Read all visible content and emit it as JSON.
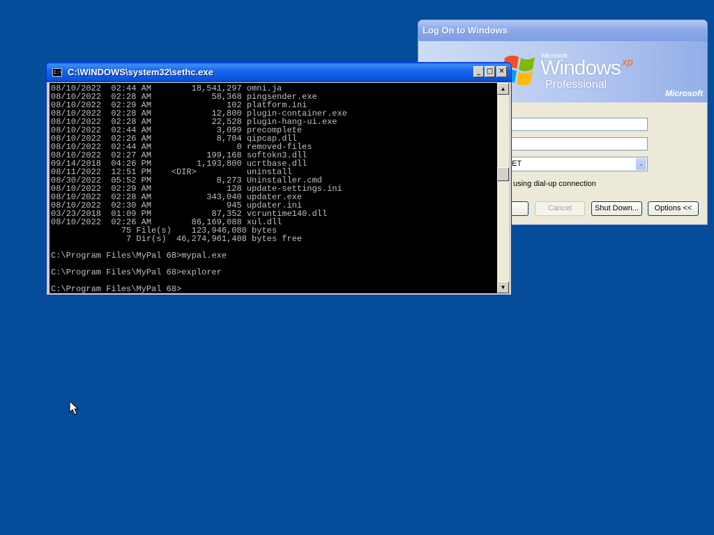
{
  "logon": {
    "title": "Log On to Windows",
    "brand_small": "Microsoft",
    "brand_windows": "Windows",
    "brand_xp": "xp",
    "brand_edition": "Professional",
    "brand_corner": "Microsoft",
    "domain_value": "ET",
    "dialup_label": "using dial-up connection",
    "cancel_label": "Cancel",
    "shutdown_label": "Shut Down...",
    "options_label": "Options <<"
  },
  "console": {
    "title": "C:\\WINDOWS\\system32\\sethc.exe",
    "minimize": "_",
    "maximize": "□",
    "close": "✕",
    "lines": [
      "08/10/2022  02:44 AM        18,541,297 omni.ja",
      "08/10/2022  02:28 AM            58,368 pingsender.exe",
      "08/10/2022  02:29 AM               102 platform.ini",
      "08/10/2022  02:28 AM            12,800 plugin-container.exe",
      "08/10/2022  02:28 AM            22,528 plugin-hang-ui.exe",
      "08/10/2022  02:44 AM             3,099 precomplete",
      "08/10/2022  02:26 AM             8,704 qipcap.dll",
      "08/10/2022  02:44 AM                 0 removed-files",
      "08/10/2022  02:27 AM           199,168 softokn3.dll",
      "09/14/2018  04:26 PM         1,193,800 ucrtbase.dll",
      "08/11/2022  12:51 PM    <DIR>          uninstall",
      "08/30/2022  05:52 PM             8,273 Uninstaller.cmd",
      "08/10/2022  02:29 AM               128 update-settings.ini",
      "08/10/2022  02:28 AM           343,040 updater.exe",
      "08/10/2022  02:30 AM               945 updater.ini",
      "03/23/2018  01:09 PM            87,352 vcruntime140.dll",
      "08/10/2022  02:26 AM        86,169,088 xul.dll",
      "              75 File(s)    123,946,080 bytes",
      "               7 Dir(s)  46,274,961,408 bytes free",
      "",
      "C:\\Program Files\\MyPal 68>mypal.exe",
      "",
      "C:\\Program Files\\MyPal 68>explorer",
      "",
      "C:\\Program Files\\MyPal 68>"
    ]
  },
  "icons": {
    "cmd": "cmd-window-icon",
    "scroll_up": "▲",
    "scroll_down": "▼",
    "select_arrow": "⌄"
  },
  "colors": {
    "desktop": "#054c9a",
    "console_bg": "#000000",
    "console_text": "#c0c0c0"
  }
}
